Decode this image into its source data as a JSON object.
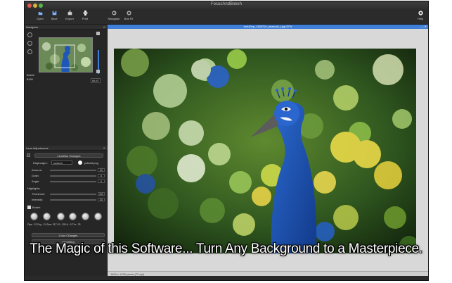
{
  "window": {
    "title": "FocusAndBokeh",
    "image_title": "reduDep_1185704_peacock_j.jpg 57%",
    "status_text": "1600 x 1200 pixels (72 dpi)"
  },
  "toolbar": {
    "open": "Open",
    "save": "Save",
    "export": "Export",
    "print": "Print",
    "navigator": "Navigator",
    "bokeh_fit": "Bok Fit",
    "help": "Help"
  },
  "navigator": {
    "header": "Navigator",
    "blocking_label": "Bokeh",
    "blocking_value": "8490",
    "zoom_value": "88.87"
  },
  "lens": {
    "header": "Lens Adjustments",
    "lensblur_button": "LensBlur Changes",
    "diaphragm_label": "Diaphragm:",
    "diaphragm_value": "custom",
    "diaphragm_file": "pdiaed.png",
    "rows": [
      {
        "label": "Amount:",
        "value": "20"
      },
      {
        "label": "Grain:",
        "value": "0"
      },
      {
        "label": "Angle:",
        "value": "0"
      }
    ],
    "highlights_label": "Highlights",
    "highlight_rows": [
      {
        "label": "Threshold:",
        "value": "200"
      },
      {
        "label": "Intensity:",
        "value": "30"
      }
    ],
    "bokeh_label": "Bokeh",
    "knob_caption": "Ope.: 70  Dry.: 11    Size: 217  K1: 100   A.: 0    Thr.: 78",
    "color_button": "Color Changes",
    "vignetting_button": "Vignetting"
  },
  "caption": "The Magic of this Software... Turn Any Background to a Masterpiece.",
  "colors": {
    "accent": "#3f7fd8",
    "peacock_blue": "#1f57b8",
    "bokeh_green": "#8fd23a",
    "bokeh_yellow": "#f3e14a"
  }
}
